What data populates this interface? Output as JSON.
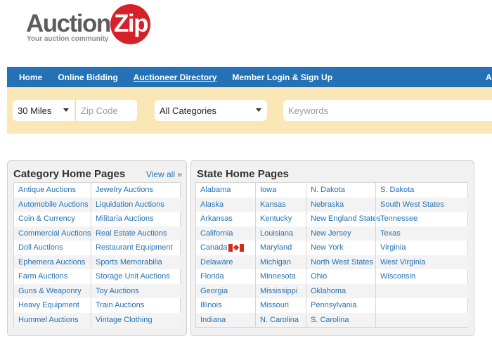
{
  "logo": {
    "text": "Auction",
    "zip": "Zip",
    "tagline": "Your auction community"
  },
  "nav": {
    "items": [
      "Home",
      "Online Bidding",
      "Auctioneer Directory",
      "Member Login & Sign Up",
      "Au"
    ]
  },
  "search": {
    "distance": "30 Miles",
    "zip_placeholder": "Zip Code",
    "category": "All Categories",
    "keywords_placeholder": "Keywords"
  },
  "category_panel": {
    "title": "Category Home Pages",
    "view_all": "View all »",
    "columns": [
      [
        "Antique Auctions",
        "Automobile Auctions",
        "Coin & Currency",
        "Commercial Auctions",
        "Doll Auctions",
        "Ephemera Auctions",
        "Farm Auctions",
        "Guns & Weaponry",
        "Heavy Equipment",
        "Hummel Auctions"
      ],
      [
        "Jewelry Auctions",
        "Liquidation Auctions",
        "Militaria Auctions",
        "Real Estate Auctions",
        "Restaurant Equipment",
        "Sports Memorabilia",
        "Storage Unit Auctions",
        "Toy Auctions",
        "Train Auctions",
        "Vintage Clothing"
      ]
    ]
  },
  "state_panel": {
    "title": "State Home Pages",
    "columns": [
      [
        "Alabama",
        "Alaska",
        "Arkansas",
        "California",
        "Canada",
        "Delaware",
        "Florida",
        "Georgia",
        "Illinois",
        "Indiana"
      ],
      [
        "Iowa",
        "Kansas",
        "Kentucky",
        "Louisiana",
        "Maryland",
        "Michigan",
        "Minnesota",
        "Mississippi",
        "Missouri",
        "N. Carolina"
      ],
      [
        "N. Dakota",
        "Nebraska",
        "New England States",
        "New Jersey",
        "New York",
        "North West States",
        "Ohio",
        "Oklahoma",
        "Pennsylvania",
        "S. Carolina"
      ],
      [
        "S. Dakota",
        "South West States",
        "Tennessee",
        "Texas",
        "Virginia",
        "West Virginia",
        "Wisconsin",
        "",
        "",
        ""
      ]
    ]
  }
}
